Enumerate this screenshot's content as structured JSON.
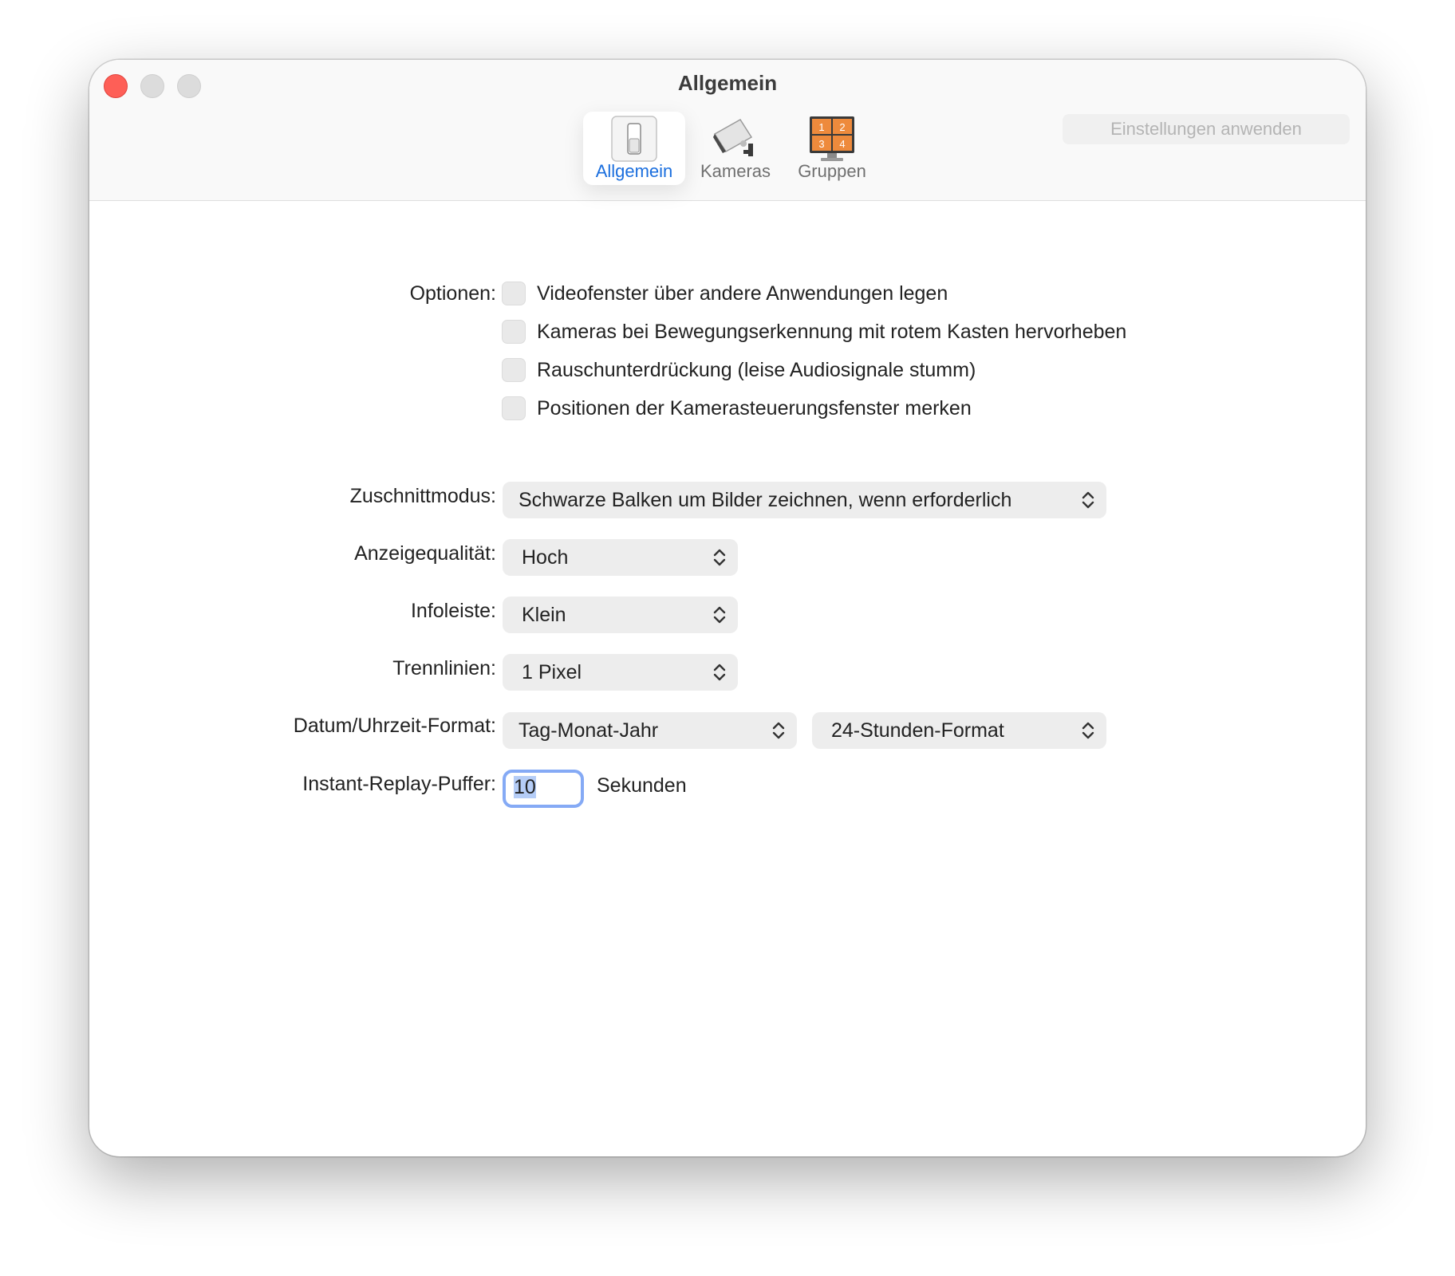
{
  "window": {
    "title": "Allgemein"
  },
  "toolbar": {
    "tabs": [
      {
        "label": "Allgemein",
        "icon": "toggle-switch-icon",
        "active": true
      },
      {
        "label": "Kameras",
        "icon": "security-camera-icon",
        "active": false
      },
      {
        "label": "Gruppen",
        "icon": "grid-monitor-icon",
        "active": false
      }
    ],
    "apply_label": "Einstellungen anwenden",
    "grid_numbers": [
      "1",
      "2",
      "3",
      "4"
    ]
  },
  "form": {
    "options_label": "Optionen:",
    "options": [
      {
        "label": "Videofenster über andere Anwendungen legen",
        "checked": false
      },
      {
        "label": "Kameras bei Bewegungserkennung mit rotem Kasten hervorheben",
        "checked": false
      },
      {
        "label": "Rauschunterdrückung (leise Audiosignale stumm)",
        "checked": false
      },
      {
        "label": "Positionen der Kamerasteuerungsfenster merken",
        "checked": false
      }
    ],
    "crop_mode_label": "Zuschnittmodus:",
    "crop_mode_value": "Schwarze Balken um Bilder zeichnen, wenn erforderlich",
    "display_quality_label": "Anzeigequalität:",
    "display_quality_value": "Hoch",
    "infobar_label": "Infoleiste:",
    "infobar_value": "Klein",
    "separator_label": "Trennlinien:",
    "separator_value": "1 Pixel",
    "datetime_label": "Datum/Uhrzeit-Format:",
    "date_format_value": "Tag-Monat-Jahr",
    "time_format_value": "24-Stunden-Format",
    "replay_label": "Instant-Replay-Puffer:",
    "replay_value": "10",
    "replay_unit": "Sekunden"
  },
  "colors": {
    "accent": "#1a6ede",
    "close_button": "#fe5f57",
    "focus_ring": "#85aaf5",
    "group_icon_orange": "#ee8a3c"
  }
}
